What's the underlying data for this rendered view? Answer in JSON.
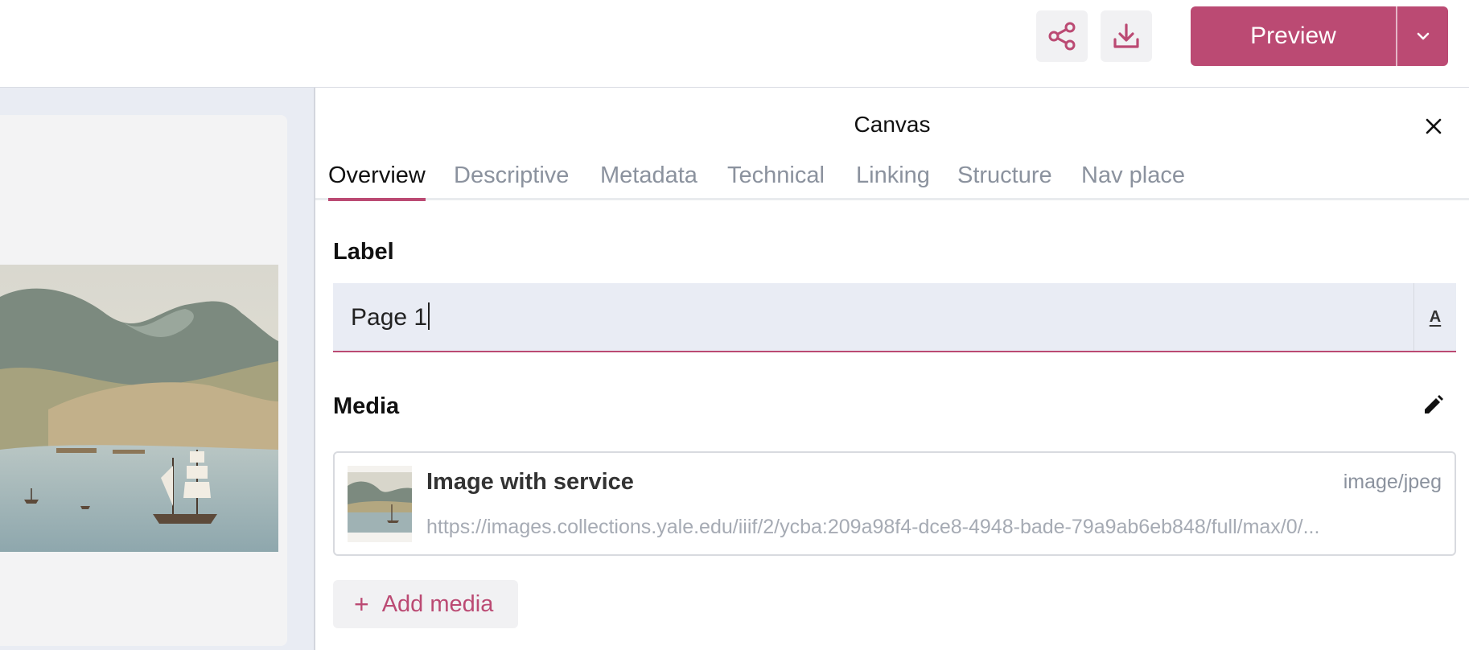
{
  "toolbar": {
    "share_icon": "share-icon",
    "download_icon": "download-icon",
    "preview_label": "Preview",
    "dropdown_icon": "chevron-down-icon"
  },
  "panel": {
    "title": "Canvas",
    "tabs": [
      {
        "label": "Overview",
        "active": true
      },
      {
        "label": "Descriptive"
      },
      {
        "label": "Metadata"
      },
      {
        "label": "Technical"
      },
      {
        "label": "Linking"
      },
      {
        "label": "Structure"
      },
      {
        "label": "Nav place"
      }
    ],
    "label_section": {
      "heading": "Label",
      "value": "Page 1",
      "language_glyph": "A"
    },
    "media_section": {
      "heading": "Media",
      "items": [
        {
          "name": "Image with service",
          "format": "image/jpeg",
          "url": "https://images.collections.yale.edu/iiif/2/ycba:209a98f4-dce8-4948-bade-79a9ab6eb848/full/max/0/..."
        }
      ],
      "add_label": "Add media"
    }
  },
  "colors": {
    "accent": "#bb4a73",
    "workspace_bg": "#e9ecf3",
    "input_bg": "#e9ecf4"
  }
}
